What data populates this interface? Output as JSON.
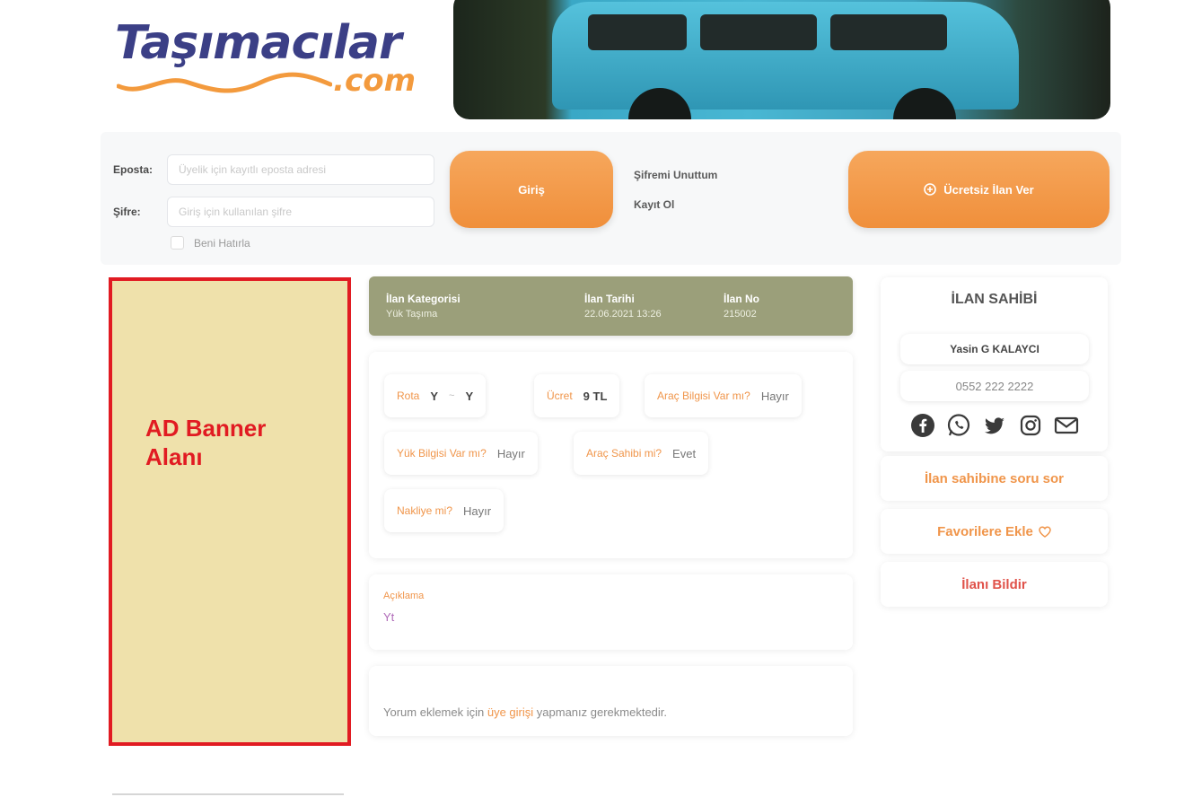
{
  "header": {
    "logo_main": "Taşımacılar",
    "logo_sub": ".com"
  },
  "login": {
    "email_label": "Eposta:",
    "email_placeholder": "Üyelik için kayıtlı eposta adresi",
    "password_label": "Şifre:",
    "password_placeholder": "Giriş için kullanılan şifre",
    "remember_label": "Beni Hatırla",
    "login_button": "Giriş",
    "forgot_password": "Şifremi Unuttum",
    "register": "Kayıt Ol",
    "post_ad_button": "Ücretsiz İlan Ver"
  },
  "ad_banner": {
    "line1": "AD Banner",
    "line2": "Alanı"
  },
  "listing_info": {
    "category_label": "İlan Kategorisi",
    "category_value": "Yük Taşıma",
    "date_label": "İlan Tarihi",
    "date_value": "22.06.2021 13:26",
    "no_label": "İlan No",
    "no_value": "215002"
  },
  "details": {
    "route_key": "Rota",
    "route_from": "Y",
    "route_tilde": "~",
    "route_to": "Y",
    "price_key": "Ücret",
    "price_value": "9 TL",
    "chip3_key": "Araç Bilgisi Var mı?",
    "chip3_value": "Hayır",
    "chip4_key": "Yük Bilgisi Var mı?",
    "chip4_value": "Hayır",
    "chip5_key": "Araç Sahibi mi?",
    "chip5_value": "Evet",
    "chip6_key": "Nakliye mi?",
    "chip6_value": "Hayır"
  },
  "description": {
    "label": "Açıklama",
    "text": "Yt"
  },
  "comments": {
    "prefix": "Yorum eklemek için",
    "link": "üye girişi",
    "suffix": "yapmanız gerekmektedir."
  },
  "owner": {
    "title": "İLAN SAHİBİ",
    "name": "Yasin G KALAYCI",
    "phone": "0552 222 2222",
    "ask_button": "İlan sahibine soru sor",
    "favorites_button": "Favorilere Ekle",
    "favorites_icon": "heart-icon",
    "report_button": "İlanı Bildir"
  },
  "colors": {
    "accent_orange": "#f0954a",
    "info_bar": "#9b9f7a",
    "banner_bg": "#efe1ab",
    "banner_red": "#e11b22",
    "report_red": "#e0524a"
  }
}
